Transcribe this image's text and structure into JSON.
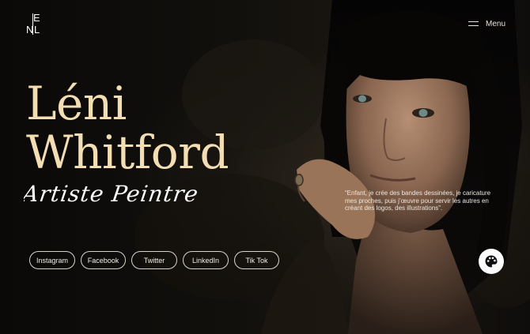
{
  "brand": {
    "logo_letters": "NLE"
  },
  "nav": {
    "menu_label": "Menu",
    "menu_icon": "hamburger-icon"
  },
  "hero": {
    "first_name": "Léni",
    "last_name": "Whitford",
    "subtitle": "Artiste Peintre",
    "quote": "“Enfant, je crée des bandes dessinées, je caricature mes proches, puis j’œuvre pour servir les autres en créant des logos, des illustrations”."
  },
  "socials": [
    {
      "label": "Instagram"
    },
    {
      "label": "Facebook"
    },
    {
      "label": "Twitter"
    },
    {
      "label": "LinkedIn"
    },
    {
      "label": "Tik Tok"
    }
  ],
  "fab": {
    "icon": "palette-icon"
  },
  "colors": {
    "background": "#0b0a09",
    "title": "#f3ddb3",
    "text": "#ece7df",
    "pill_border": "#d9d3c9"
  }
}
